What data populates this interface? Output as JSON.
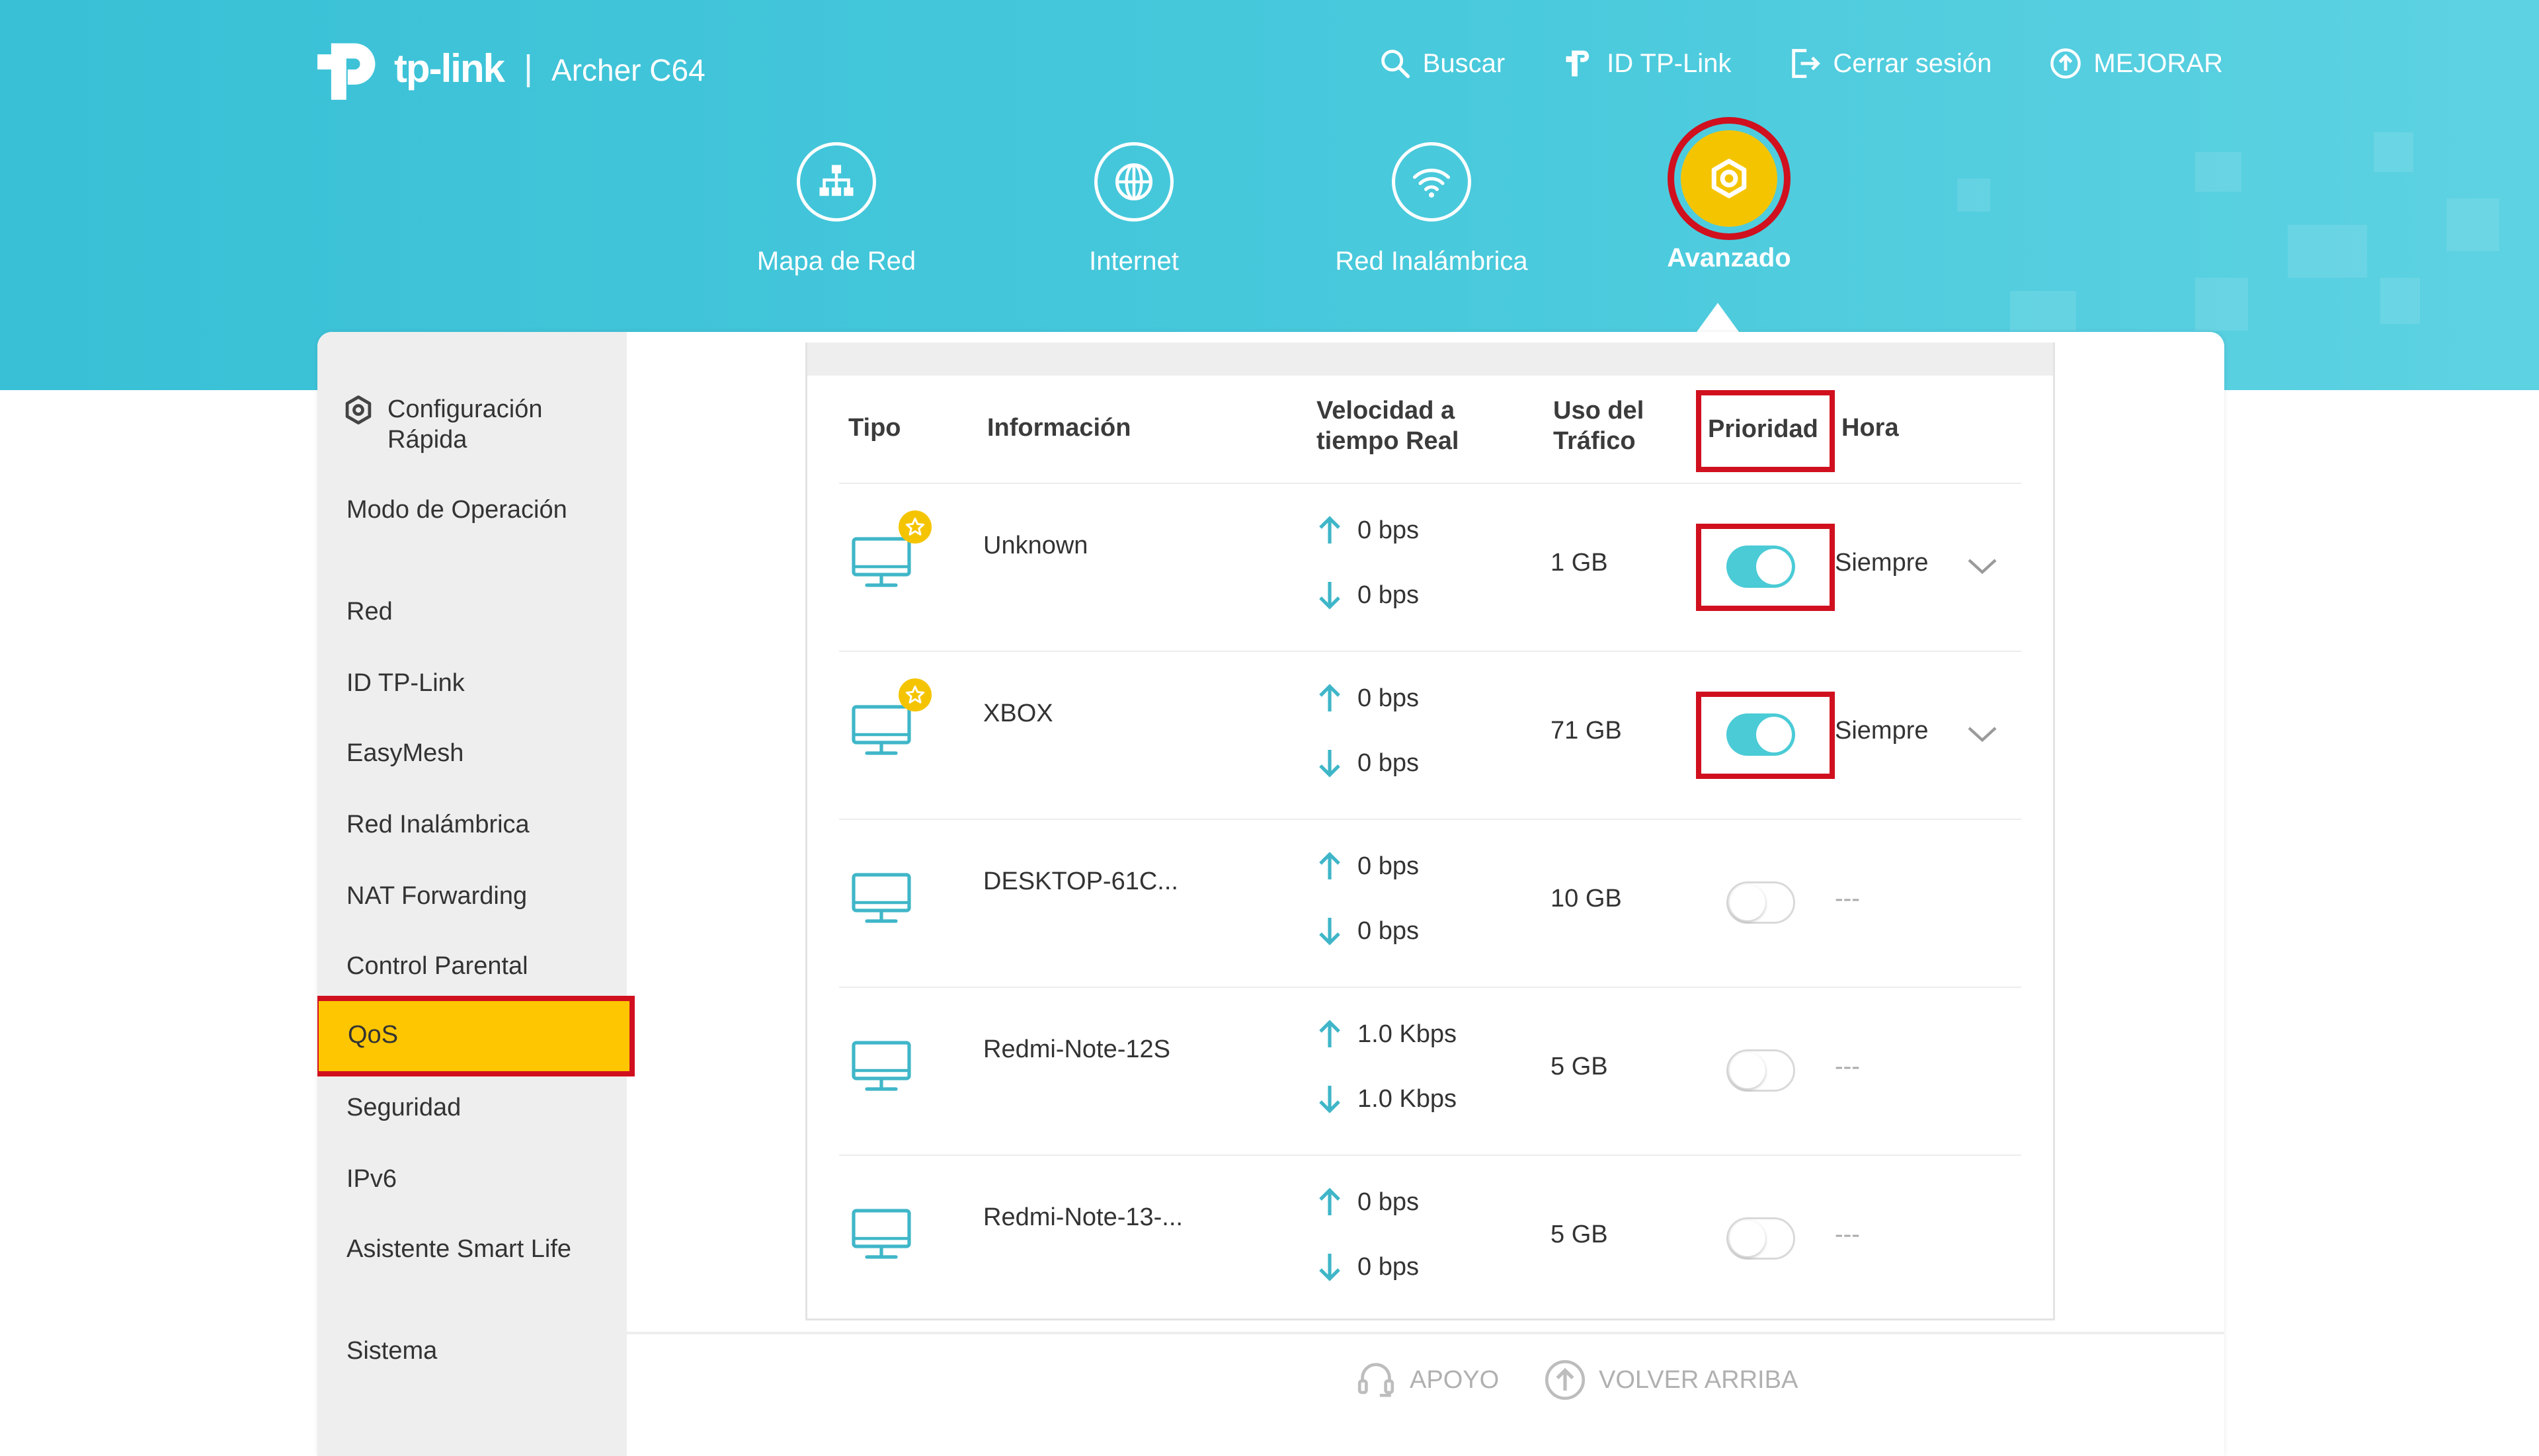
{
  "header": {
    "logo_text": "tp-link",
    "model": "Archer C64",
    "nav": [
      {
        "label": "Buscar",
        "icon": "search-icon"
      },
      {
        "label": "ID TP-Link",
        "icon": "tplink-id-icon"
      },
      {
        "label": "Cerrar sesión",
        "icon": "logout-icon"
      },
      {
        "label": "MEJORAR",
        "icon": "upgrade-icon"
      }
    ]
  },
  "main_nav": [
    {
      "label": "Mapa de Red",
      "icon": "network-map-icon"
    },
    {
      "label": "Internet",
      "icon": "globe-icon"
    },
    {
      "label": "Red Inalámbrica",
      "icon": "wifi-icon"
    },
    {
      "label": "Avanzado",
      "icon": "gear-icon",
      "active": true
    }
  ],
  "sidebar": {
    "items": [
      {
        "label": "Configuración Rápida"
      },
      {
        "label": "Modo de Operación"
      },
      {
        "label": "Red"
      },
      {
        "label": "ID TP-Link"
      },
      {
        "label": "EasyMesh"
      },
      {
        "label": "Red Inalámbrica"
      },
      {
        "label": "NAT Forwarding"
      },
      {
        "label": "Control Parental"
      },
      {
        "label": "QoS",
        "active": true
      },
      {
        "label": "Seguridad"
      },
      {
        "label": "IPv6"
      },
      {
        "label": "Asistente Smart Life"
      },
      {
        "label": "Sistema"
      }
    ]
  },
  "table": {
    "headers": {
      "tipo": "Tipo",
      "info": "Información",
      "velocidad": "Velocidad a tiempo Real",
      "uso": "Uso del Tráfico",
      "prioridad": "Prioridad",
      "hora": "Hora"
    },
    "rows": [
      {
        "name": "Unknown",
        "up": "0 bps",
        "down": "0 bps",
        "traffic": "1 GB",
        "priority": true,
        "hora": "Siempre",
        "starred": true
      },
      {
        "name": "XBOX",
        "up": "0 bps",
        "down": "0 bps",
        "traffic": "71 GB",
        "priority": true,
        "hora": "Siempre",
        "starred": true
      },
      {
        "name": "DESKTOP-61C...",
        "up": "0 bps",
        "down": "0 bps",
        "traffic": "10 GB",
        "priority": false,
        "hora": "---",
        "starred": false
      },
      {
        "name": "Redmi-Note-12S",
        "up": "1.0 Kbps",
        "down": "1.0 Kbps",
        "traffic": "5 GB",
        "priority": false,
        "hora": "---",
        "starred": false
      },
      {
        "name": "Redmi-Note-13-...",
        "up": "0 bps",
        "down": "0 bps",
        "traffic": "5 GB",
        "priority": false,
        "hora": "---",
        "starred": false
      }
    ]
  },
  "footer": {
    "support": "APOYO",
    "back_to_top": "VOLVER ARRIBA"
  },
  "colors": {
    "banner": "#48c9dc",
    "accent_yellow": "#fec601",
    "highlight_red": "#d0101e",
    "toggle_on": "#4acbd6"
  }
}
